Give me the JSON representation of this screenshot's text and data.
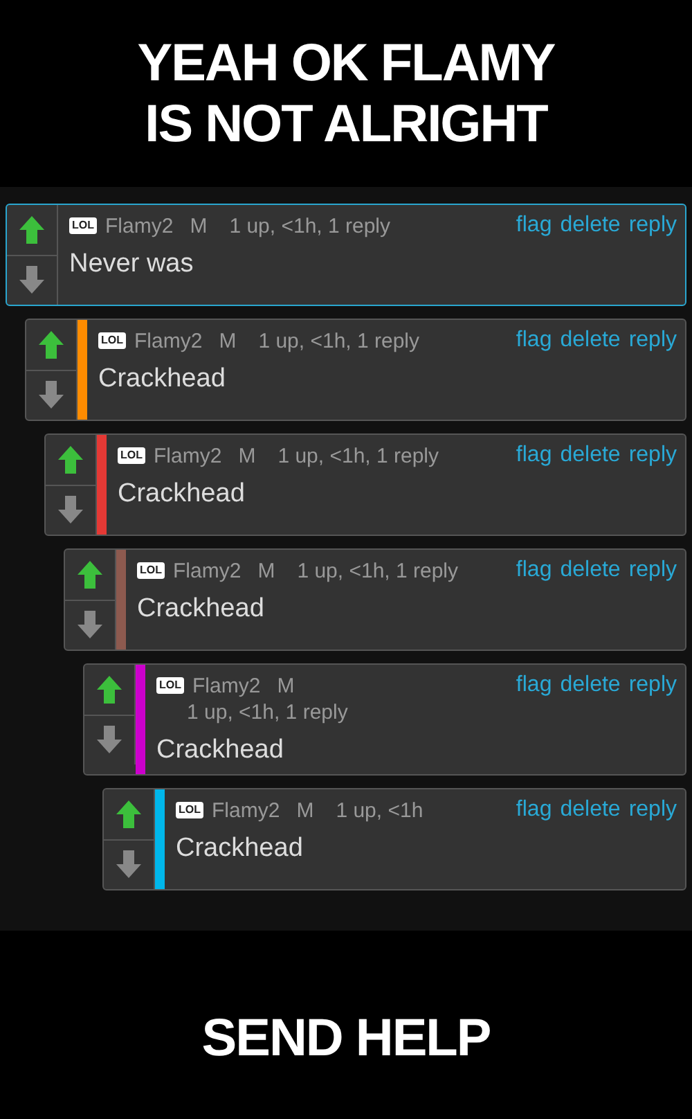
{
  "top_caption": "YEAH OK FLAMY IS NOT ALRIGHT",
  "comments": [
    {
      "badge": "LOL",
      "author": "Flamy2",
      "flag_letter": "M",
      "meta": "1 up, <1h, 1 reply",
      "actions": [
        "flag",
        "delete",
        "reply"
      ],
      "text": "Never was",
      "selected": true,
      "kind": "inline"
    },
    {
      "badge": "LOL",
      "author": "Flamy2",
      "flag_letter": "M",
      "meta": "1 up, <1h, 1 reply",
      "actions": [
        "flag",
        "delete",
        "reply"
      ],
      "text": "Crackhead",
      "selected": false,
      "kind": "inline",
      "color": "#ff8c00"
    },
    {
      "badge": "LOL",
      "author": "Flamy2",
      "flag_letter": "M",
      "meta": "1 up, <1h, 1 reply",
      "actions": [
        "flag",
        "delete",
        "reply"
      ],
      "text": "Crackhead",
      "selected": false,
      "kind": "inline",
      "color": "#e53935"
    },
    {
      "badge": "LOL",
      "author": "Flamy2",
      "flag_letter": "M",
      "meta": "1 up, <1h, 1 reply",
      "actions": [
        "flag",
        "delete",
        "reply"
      ],
      "text": "Crackhead",
      "selected": false,
      "kind": "inline",
      "color": "#8d5a4f"
    },
    {
      "badge": "LOL",
      "author": "Flamy2",
      "flag_letter": "M",
      "meta": "1 up, <1h, 1 reply",
      "actions": [
        "flag",
        "delete",
        "reply"
      ],
      "text": "Crackhead",
      "selected": false,
      "kind": "stacked",
      "color": "#cc00cc"
    },
    {
      "badge": "LOL",
      "author": "Flamy2",
      "flag_letter": "M",
      "meta": "1 up, <1h",
      "actions": [
        "flag",
        "delete",
        "reply"
      ],
      "text": "Crackhead",
      "selected": false,
      "kind": "inline",
      "color": "#00b7eb"
    }
  ],
  "bottom_caption": "SEND HELP"
}
